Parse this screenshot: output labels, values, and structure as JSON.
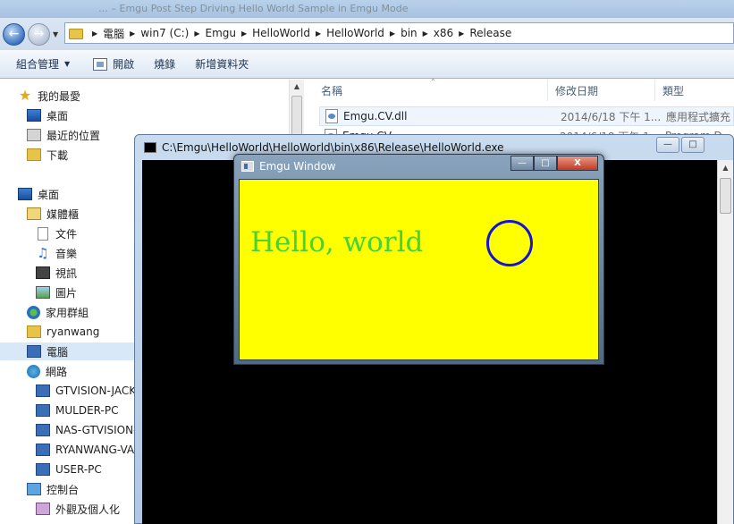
{
  "explorer": {
    "titlebar_text": "… – Emgu Post Step Driving Hello World Sample in Emgu Mode",
    "address": {
      "crumbs": [
        "電腦",
        "win7 (C:)",
        "Emgu",
        "HelloWorld",
        "HelloWorld",
        "bin",
        "x86",
        "Release"
      ]
    },
    "toolbar": {
      "organize": "組合管理",
      "open": "開啟",
      "burn": "燒錄",
      "new_folder": "新增資料夾"
    },
    "nav": [
      {
        "label": "我的最愛"
      },
      {
        "label": "桌面"
      },
      {
        "label": "最近的位置"
      },
      {
        "label": "下載"
      },
      {
        "label": "桌面"
      },
      {
        "label": "媒體櫃"
      },
      {
        "label": "文件"
      },
      {
        "label": "音樂"
      },
      {
        "label": "視訊"
      },
      {
        "label": "圖片"
      },
      {
        "label": "家用群組"
      },
      {
        "label": "ryanwang"
      },
      {
        "label": "電腦"
      },
      {
        "label": "網路"
      },
      {
        "label": "GTVISION-JACK"
      },
      {
        "label": "MULDER-PC"
      },
      {
        "label": "NAS-GTVISION-"
      },
      {
        "label": "RYANWANG-VA"
      },
      {
        "label": "USER-PC"
      },
      {
        "label": "控制台"
      },
      {
        "label": "外觀及個人化"
      }
    ],
    "columns": {
      "name": "名稱",
      "date": "修改日期",
      "type": "類型"
    },
    "files": [
      {
        "name": "Emgu.CV.dll",
        "date": "2014/6/18 下午 1...",
        "type": "應用程式擴充"
      },
      {
        "name": "Emgu.CV...",
        "date": "2014/6/18 下午 1...",
        "type": "Program D..."
      }
    ]
  },
  "console": {
    "title": "C:\\Emgu\\HelloWorld\\HelloWorld\\bin\\x86\\Release\\HelloWorld.exe",
    "minimize": "—",
    "maximize": "□"
  },
  "emgu_window": {
    "title": "Emgu Window",
    "minimize": "—",
    "maximize": "□",
    "close": "X",
    "text": "Hello, world",
    "bg_color": "#ffff00",
    "text_color": "#44d43a",
    "circle_color": "#1414d8"
  }
}
